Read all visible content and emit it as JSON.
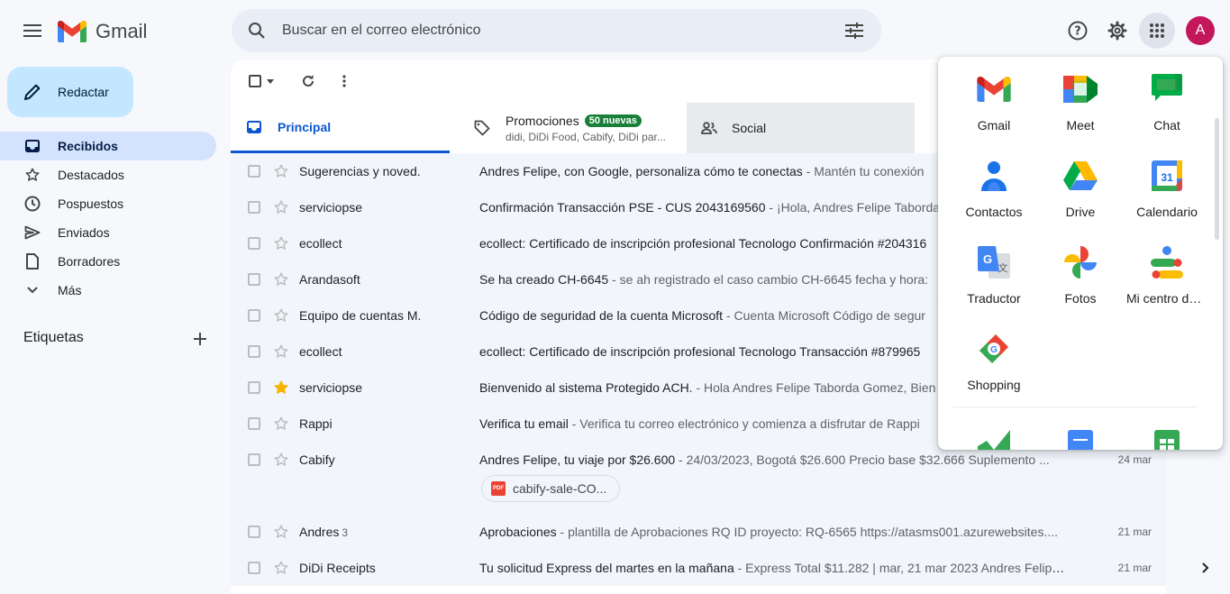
{
  "header": {
    "logo_text": "Gmail",
    "search_placeholder": "Buscar en el correo electrónico",
    "avatar_letter": "A"
  },
  "sidebar": {
    "compose_label": "Redactar",
    "items": [
      {
        "label": "Recibidos",
        "icon": "inbox-icon",
        "active": true
      },
      {
        "label": "Destacados",
        "icon": "star-icon"
      },
      {
        "label": "Pospuestos",
        "icon": "clock-icon"
      },
      {
        "label": "Enviados",
        "icon": "send-icon"
      },
      {
        "label": "Borradores",
        "icon": "draft-icon"
      },
      {
        "label": "Más",
        "icon": "chevron-down-icon"
      }
    ],
    "labels_title": "Etiquetas"
  },
  "tabs": {
    "principal": "Principal",
    "promos": "Promociones",
    "promos_badge": "50 nuevas",
    "promos_sub": "didi, DiDi Food, Cabify, DiDi par...",
    "social": "Social"
  },
  "emails": [
    {
      "sender": "Sugerencias y noved.",
      "subject": "Andres Felipe, con Google, personaliza cómo te conectas",
      "snippet": " - Mantén tu conexión",
      "starred": false
    },
    {
      "sender": "serviciopse",
      "subject": "Confirmación Transacción PSE - CUS 2043169560",
      "snippet": " - ¡Hola, Andres Felipe Taborda",
      "starred": false
    },
    {
      "sender": "ecollect",
      "subject": "ecollect: Certificado de inscripción profesional Tecnologo Confirmación #204316",
      "snippet": "",
      "starred": false
    },
    {
      "sender": "Arandasoft",
      "subject": "Se ha creado CH-6645",
      "snippet": " - se ah registrado el caso cambio CH-6645 fecha y hora:",
      "starred": false
    },
    {
      "sender": "Equipo de cuentas M.",
      "subject": "Código de seguridad de la cuenta Microsoft",
      "snippet": " - Cuenta Microsoft Código de segur",
      "starred": false
    },
    {
      "sender": "ecollect",
      "subject": "ecollect: Certificado de inscripción profesional Tecnologo Transacción #879965",
      "snippet": "",
      "starred": false
    },
    {
      "sender": "serviciopse",
      "subject": "Bienvenido al sistema Protegido ACH.",
      "snippet": " - Hola Andres Felipe Taborda Gomez, Bien",
      "starred": true
    },
    {
      "sender": "Rappi",
      "subject": "Verifica tu email",
      "snippet": " - Verifica tu correo electrónico y comienza a disfrutar de Rappi",
      "starred": false
    },
    {
      "sender": "Cabify",
      "subject": "Andres Felipe, tu viaje por $26.600",
      "snippet": " - 24/03/2023, Bogotá $26.600 Precio base $32.666 Suplemento ...",
      "date": "24 mar",
      "attachment": "cabify-sale-CO...",
      "starred": false
    },
    {
      "sender": "Andres",
      "count": "3",
      "subject": "Aprobaciones",
      "snippet": " - plantilla de Aprobaciones RQ ID proyecto: RQ-6565 https://atasms001.azurewebsites....",
      "date": "21 mar",
      "starred": false
    },
    {
      "sender": "DiDi Receipts",
      "subject": "Tu solicitud Express del martes en la mañana",
      "snippet": " - Express Total $11.282 | mar, 21 mar 2023 Andres Felipe,...",
      "date": "21 mar",
      "starred": false
    }
  ],
  "apps": [
    {
      "label": "Gmail",
      "icon": "gmail-icon"
    },
    {
      "label": "Meet",
      "icon": "meet-icon"
    },
    {
      "label": "Chat",
      "icon": "chat-icon"
    },
    {
      "label": "Contactos",
      "icon": "contacts-icon"
    },
    {
      "label": "Drive",
      "icon": "drive-icon"
    },
    {
      "label": "Calendario",
      "icon": "calendar-icon",
      "calendar_day": "31"
    },
    {
      "label": "Traductor",
      "icon": "translate-icon"
    },
    {
      "label": "Fotos",
      "icon": "photos-icon"
    },
    {
      "label": "Mi centro de anuncios",
      "icon": "ads-center-icon"
    },
    {
      "label": "Shopping",
      "icon": "shopping-icon"
    }
  ],
  "colors": {
    "accent": "#0b57d0",
    "compose_bg": "#c2e7ff",
    "active_nav": "#d3e3fd",
    "badge_green": "#188038",
    "avatar": "#c2185b",
    "star_yellow": "#f4b400"
  }
}
